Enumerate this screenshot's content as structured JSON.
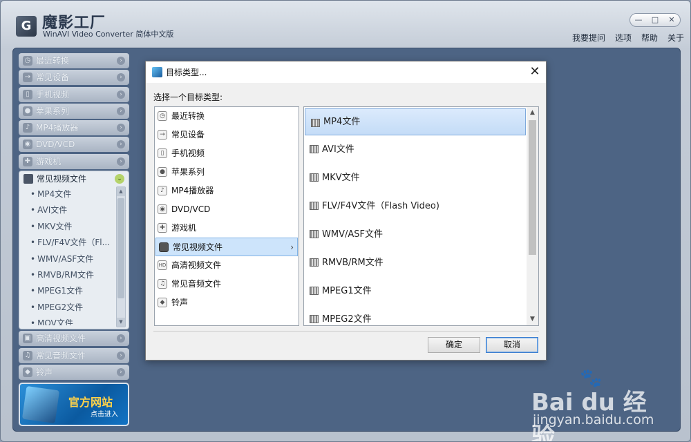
{
  "app": {
    "logo_glyph": "G",
    "title": "魔影工厂",
    "subtitle": "WinAVI Video Converter 简体中文版"
  },
  "window_buttons": {
    "minimize": "—",
    "maximize": "□",
    "close": "✕"
  },
  "top_menu": [
    "我要提问",
    "选项",
    "帮助",
    "关于"
  ],
  "sidebar": {
    "items_top": [
      {
        "label": "最近转换",
        "icon": "clock-icon"
      },
      {
        "label": "常见设备",
        "icon": "device-icon"
      },
      {
        "label": "手机视频",
        "icon": "phone-icon"
      },
      {
        "label": "苹果系列",
        "icon": "apple-icon"
      },
      {
        "label": "MP4播放器",
        "icon": "mp4-player-icon"
      },
      {
        "label": "DVD/VCD",
        "icon": "disc-icon"
      },
      {
        "label": "游戏机",
        "icon": "gamepad-icon"
      }
    ],
    "open_group": {
      "label": "常见视频文件",
      "items": [
        "MP4文件",
        "AVI文件",
        "MKV文件",
        "FLV/F4V文件（Fl...",
        "WMV/ASF文件",
        "RMVB/RM文件",
        "MPEG1文件",
        "MPEG2文件",
        "MOV文件"
      ]
    },
    "items_bottom": [
      {
        "label": "高清视频文件",
        "icon": "hd-icon"
      },
      {
        "label": "常见音频文件",
        "icon": "music-icon"
      },
      {
        "label": "铃声",
        "icon": "bell-icon"
      }
    ],
    "arrow_glyph": "›",
    "open_arrow_glyph": "⌄"
  },
  "banner": {
    "title": "官方网站",
    "subtitle": "点击进入"
  },
  "dialog": {
    "title": "目标类型...",
    "close_glyph": "✕",
    "prompt": "选择一个目标类型:",
    "categories": [
      {
        "label": "最近转换",
        "icon": "clock-icon",
        "glyph": "◷"
      },
      {
        "label": "常见设备",
        "icon": "device-icon",
        "glyph": "→"
      },
      {
        "label": "手机视频",
        "icon": "phone-icon",
        "glyph": "▯"
      },
      {
        "label": "苹果系列",
        "icon": "apple-icon",
        "glyph": "●"
      },
      {
        "label": "MP4播放器",
        "icon": "mp4-player-icon",
        "glyph": "♪"
      },
      {
        "label": "DVD/VCD",
        "icon": "disc-icon",
        "glyph": "◉"
      },
      {
        "label": "游戏机",
        "icon": "gamepad-icon",
        "glyph": "✚"
      },
      {
        "label": "常见视频文件",
        "icon": "film-icon",
        "glyph": "▦",
        "selected": true
      },
      {
        "label": "高清视频文件",
        "icon": "hd-icon",
        "glyph": "HD"
      },
      {
        "label": "常见音频文件",
        "icon": "music-icon",
        "glyph": "♫"
      },
      {
        "label": "铃声",
        "icon": "bell-icon",
        "glyph": "◆"
      }
    ],
    "selected_chevron": "›",
    "file_types": [
      {
        "label": "MP4文件",
        "selected": true
      },
      {
        "label": "AVI文件"
      },
      {
        "label": "MKV文件"
      },
      {
        "label": "FLV/F4V文件（Flash Video)"
      },
      {
        "label": "WMV/ASF文件"
      },
      {
        "label": "RMVB/RM文件"
      },
      {
        "label": "MPEG1文件"
      },
      {
        "label": "MPEG2文件"
      }
    ],
    "scroll_up": "▲",
    "scroll_down": "▼",
    "ok_label": "确定",
    "cancel_label": "取消"
  },
  "watermark": {
    "logo": "Bai du 经验",
    "paw": "🐾",
    "url": "jingyan.baidu.com"
  }
}
